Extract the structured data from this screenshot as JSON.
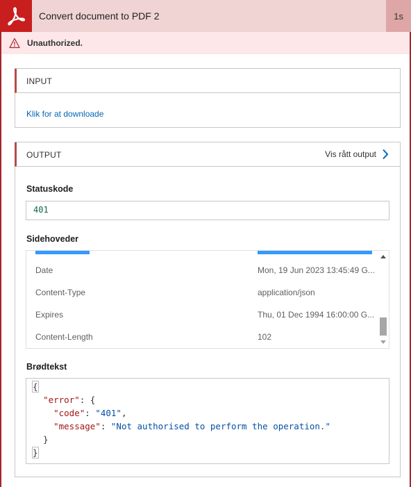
{
  "header": {
    "title": "Convert document to PDF 2",
    "duration": "1s"
  },
  "error": {
    "message": "Unauthorized."
  },
  "input": {
    "section_label": "INPUT",
    "download_link": "Klik for at downloade"
  },
  "output": {
    "section_label": "OUTPUT",
    "raw_output_link": "Vis rått output",
    "status_code_label": "Statuskode",
    "status_code": "401",
    "headers_label": "Sidehoveder",
    "headers": [
      {
        "key": "Date",
        "value": "Mon, 19 Jun 2023 13:45:49 G..."
      },
      {
        "key": "Content-Type",
        "value": "application/json"
      },
      {
        "key": "Expires",
        "value": "Thu, 01 Dec 1994 16:00:00 G..."
      },
      {
        "key": "Content-Length",
        "value": "102"
      }
    ],
    "body_label": "Brødtekst",
    "body": {
      "error_key": "\"error\"",
      "code_key": "\"code\"",
      "code_value": "\"401\"",
      "message_key": "\"message\"",
      "message_value": "\"Not authorised to perform the operation.\""
    }
  },
  "colors": {
    "brand": "#c81e1e",
    "header_bg": "#f0d4d4",
    "error_bg": "#fde7e9",
    "link": "#0067b8",
    "status_code": "#116644"
  },
  "icons": {
    "logo": "adobe-acrobat-icon",
    "warning": "warning-icon",
    "chevron": "chevron-right-icon"
  }
}
